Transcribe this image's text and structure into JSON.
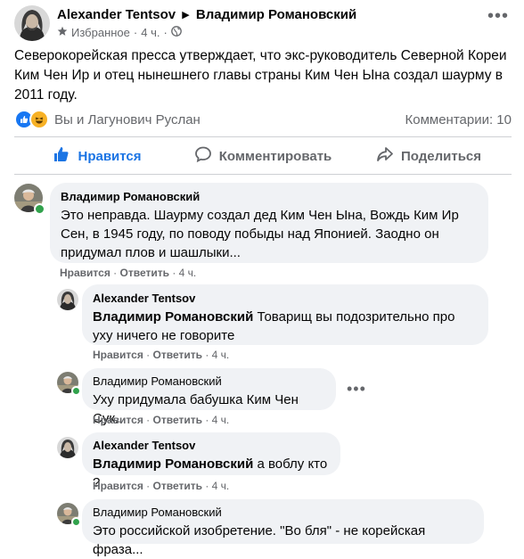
{
  "post": {
    "author": "Alexander Tentsov",
    "target": "Владимир Романовский",
    "audience": "Избранное",
    "time": "4 ч.",
    "text": "Северокорейская пресса утверждает, что экс-руководитель Северной Кореи Ким Чен Ир и отец нынешнего главы страны Ким Чен Ына создал шаурму в 2011 году.",
    "reactions_text": "Вы и Лагунович Руслан",
    "comments_count": "Комментарии: 10"
  },
  "actions": {
    "like": "Нравится",
    "comment": "Комментировать",
    "share": "Поделиться"
  },
  "comments": [
    {
      "name": "Владимир Романовский",
      "mention": "",
      "text": "Это неправда. Шаурму создал дед Ким Чен Ына, Вождь Ким Ир Сен, в 1945 году, по поводу побыды над Японией. Заодно он придумал плов и шашлыки...",
      "like": "Нравится",
      "reply": "Ответить",
      "time": "4 ч."
    },
    {
      "name": "Alexander Tentsov",
      "mention": "Владимир Романовский",
      "text": " Товарищ вы подозрительно про уху ничего не говорите",
      "like": "Нравится",
      "reply": "Ответить",
      "time": "4 ч."
    },
    {
      "name": "Владимир Романовский",
      "mention": "",
      "text": "Уху придумала бабушка Ким Чен Сук..",
      "like": "Нравится",
      "reply": "Ответить",
      "time": "4 ч."
    },
    {
      "name": "Alexander Tentsov",
      "mention": "Владимир Романовский",
      "text": " а воблу кто ?",
      "like": "Нравится",
      "reply": "Ответить",
      "time": "4 ч."
    },
    {
      "name": "Владимир Романовский",
      "mention": "",
      "text": "Это российской изобретение. \"Во бля\" - не корейская фраза...",
      "like": "",
      "reply": "",
      "time": ""
    }
  ],
  "sep": "·",
  "colors": {
    "accent": "#1b74e4",
    "bubble": "#f0f2f5",
    "muted": "#65676b",
    "online": "#31a24c"
  },
  "icons": [
    "globe-icon",
    "more-icon",
    "like-reaction-icon",
    "haha-reaction-icon",
    "thumbs-up-icon",
    "comment-icon",
    "share-icon",
    "avatar-alexander",
    "avatar-vladimir"
  ]
}
